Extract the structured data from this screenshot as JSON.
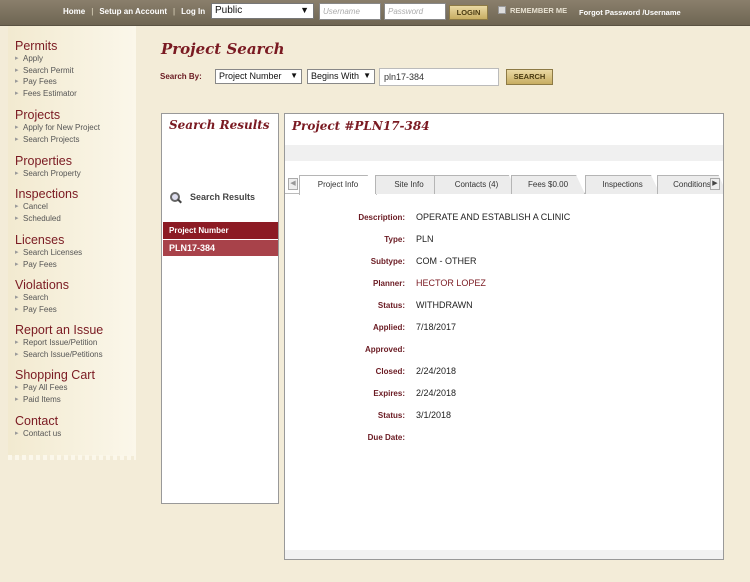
{
  "topbar": {
    "links": [
      "Home",
      "Setup an Account",
      "Log In"
    ],
    "separator": "|",
    "account_type": "Public",
    "username_placeholder": "Username",
    "password_placeholder": "Password",
    "login_label": "LOGIN",
    "remember_label": "REMEMBER ME",
    "forgot_label": "Forgot Password /Username"
  },
  "sidebar": [
    {
      "title": "Permits",
      "items": [
        "Apply",
        "Search Permit",
        "Pay Fees",
        "Fees Estimator"
      ]
    },
    {
      "title": "Projects",
      "items": [
        "Apply for New Project",
        "Search Projects"
      ]
    },
    {
      "title": "Properties",
      "items": [
        "Search Property"
      ]
    },
    {
      "title": "Inspections",
      "items": [
        "Cancel",
        "Scheduled"
      ]
    },
    {
      "title": "Licenses",
      "items": [
        "Search Licenses",
        "Pay Fees"
      ]
    },
    {
      "title": "Violations",
      "items": [
        "Search",
        "Pay Fees"
      ]
    },
    {
      "title": "Report an Issue",
      "items": [
        "Report Issue/Petition",
        "Search Issue/Petitions"
      ]
    },
    {
      "title": "Shopping Cart",
      "items": [
        "Pay All Fees",
        "Paid Items"
      ]
    },
    {
      "title": "Contact",
      "items": [
        "Contact us"
      ]
    }
  ],
  "main": {
    "title": "Project Search",
    "search_by_label": "Search By:",
    "field_select": "Project Number",
    "operator_select": "Begins With",
    "search_value": "pln17-384",
    "search_button": "SEARCH"
  },
  "results": {
    "title": "Search Results",
    "link_label": "Search Results",
    "column_header": "Project Number",
    "rows": [
      "PLN17-384"
    ]
  },
  "detail": {
    "title": "Project #PLN17-384",
    "tabs": [
      "Project Info",
      "Site Info",
      "Contacts (4)",
      "Fees $0.00",
      "Inspections",
      "Conditions"
    ],
    "active_tab": "Project Info",
    "fields": [
      {
        "label": "Description:",
        "value": "OPERATE AND ESTABLISH A CLINIC"
      },
      {
        "label": "Type:",
        "value": "PLN"
      },
      {
        "label": "Subtype:",
        "value": "COM - OTHER"
      },
      {
        "label": "Planner:",
        "value": "HECTOR LOPEZ"
      },
      {
        "label": "Status:",
        "value": "WITHDRAWN"
      },
      {
        "label": "Applied:",
        "value": "7/18/2017"
      },
      {
        "label": "Approved:",
        "value": ""
      },
      {
        "label": "Closed:",
        "value": "2/24/2018"
      },
      {
        "label": "Expires:",
        "value": "2/24/2018"
      },
      {
        "label": "Status:",
        "value": "3/1/2018"
      },
      {
        "label": "Due Date:",
        "value": ""
      }
    ]
  },
  "colors": {
    "brand": "#7a1a22",
    "header_row": "#8c1b24",
    "selected_row": "#a8424a",
    "button_gold": "#c7ad62"
  }
}
